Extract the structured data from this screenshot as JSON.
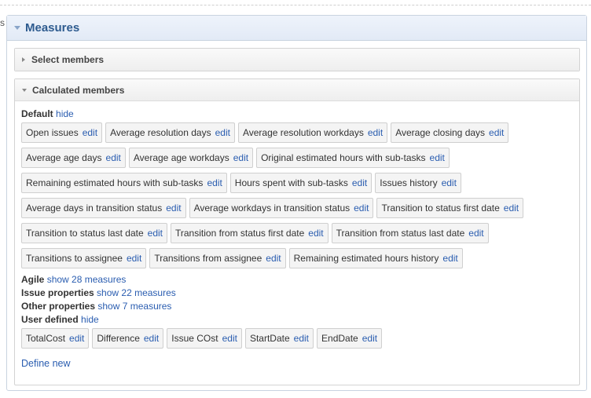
{
  "left_mark": "s",
  "measures": {
    "title": "Measures",
    "select_members": {
      "title": "Select members"
    },
    "calculated_members": {
      "title": "Calculated members",
      "default": {
        "label": "Default",
        "toggle": "hide",
        "items": [
          {
            "name": "Open issues",
            "edit": "edit"
          },
          {
            "name": "Average resolution days",
            "edit": "edit"
          },
          {
            "name": "Average resolution workdays",
            "edit": "edit"
          },
          {
            "name": "Average closing days",
            "edit": "edit"
          },
          {
            "name": "Average age days",
            "edit": "edit"
          },
          {
            "name": "Average age workdays",
            "edit": "edit"
          },
          {
            "name": "Original estimated hours with sub-tasks",
            "edit": "edit"
          },
          {
            "name": "Remaining estimated hours with sub-tasks",
            "edit": "edit"
          },
          {
            "name": "Hours spent with sub-tasks",
            "edit": "edit"
          },
          {
            "name": "Issues history",
            "edit": "edit"
          },
          {
            "name": "Average days in transition status",
            "edit": "edit"
          },
          {
            "name": "Average workdays in transition status",
            "edit": "edit"
          },
          {
            "name": "Transition to status first date",
            "edit": "edit"
          },
          {
            "name": "Transition to status last date",
            "edit": "edit"
          },
          {
            "name": "Transition from status first date",
            "edit": "edit"
          },
          {
            "name": "Transition from status last date",
            "edit": "edit"
          },
          {
            "name": "Transitions to assignee",
            "edit": "edit"
          },
          {
            "name": "Transitions from assignee",
            "edit": "edit"
          },
          {
            "name": "Remaining estimated hours history",
            "edit": "edit"
          }
        ]
      },
      "agile": {
        "label": "Agile",
        "toggle": "show 28 measures"
      },
      "issue_properties": {
        "label": "Issue properties",
        "toggle": "show 22 measures"
      },
      "other_properties": {
        "label": "Other properties",
        "toggle": "show 7 measures"
      },
      "user_defined": {
        "label": "User defined",
        "toggle": "hide",
        "items": [
          {
            "name": "TotalCost",
            "edit": "edit"
          },
          {
            "name": "Difference",
            "edit": "edit"
          },
          {
            "name": "Issue COst",
            "edit": "edit"
          },
          {
            "name": "StartDate",
            "edit": "edit"
          },
          {
            "name": "EndDate",
            "edit": "edit"
          }
        ]
      },
      "define_new": "Define new"
    }
  }
}
